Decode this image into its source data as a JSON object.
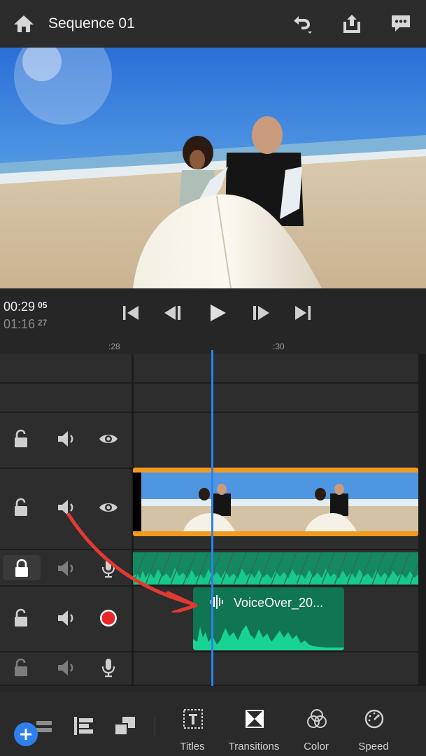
{
  "header": {
    "title": "Sequence 01",
    "icons": [
      "home-icon",
      "undo-icon",
      "share-icon",
      "feedback-icon"
    ]
  },
  "transport": {
    "current_time": "00:29",
    "current_frames": "05",
    "total_time": "01:16",
    "total_frames": "27",
    "controls": [
      "skip-to-start",
      "step-back",
      "play",
      "step-forward",
      "skip-to-end"
    ]
  },
  "ruler": {
    "tick_left": ":28",
    "tick_right": ":30"
  },
  "tracks": {
    "voice_clip_label": "VoiceOver_20..."
  },
  "toolbar": {
    "items": [
      {
        "label": "Titles"
      },
      {
        "label": "Transitions"
      },
      {
        "label": "Color"
      },
      {
        "label": "Speed"
      }
    ]
  },
  "colors": {
    "accent": "#2f80ed",
    "clip_border": "#f29a1f",
    "audio_green": "#17c98a",
    "record_red": "#e8272c"
  }
}
